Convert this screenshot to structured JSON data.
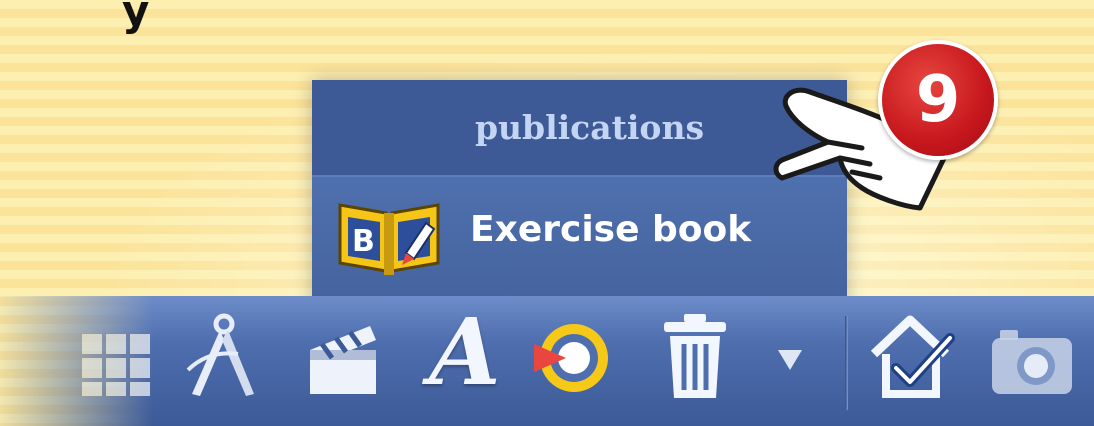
{
  "page": {
    "partial_top_text": "y"
  },
  "menu": {
    "title": "publications",
    "items": [
      {
        "label": "Exercise book",
        "icon": "exercise-book-icon"
      }
    ]
  },
  "toolbar": {
    "buttons": [
      {
        "icon": "grid-icon"
      },
      {
        "icon": "compass-icon"
      },
      {
        "icon": "clapperboard-icon"
      },
      {
        "icon": "text-icon",
        "glyph": "A"
      },
      {
        "icon": "record-icon"
      },
      {
        "icon": "trash-icon"
      },
      {
        "icon": "dropdown-arrow-icon"
      },
      {
        "icon": "home-check-icon"
      },
      {
        "icon": "camera-icon"
      }
    ]
  },
  "callout": {
    "number": "9",
    "icon": "pointing-hand-icon"
  },
  "colors": {
    "background": "#fdefb0",
    "menu": "#4a6aa6",
    "menu_header": "#3e5a96",
    "badge": "#c6171d",
    "book_yellow": "#f5c518"
  }
}
